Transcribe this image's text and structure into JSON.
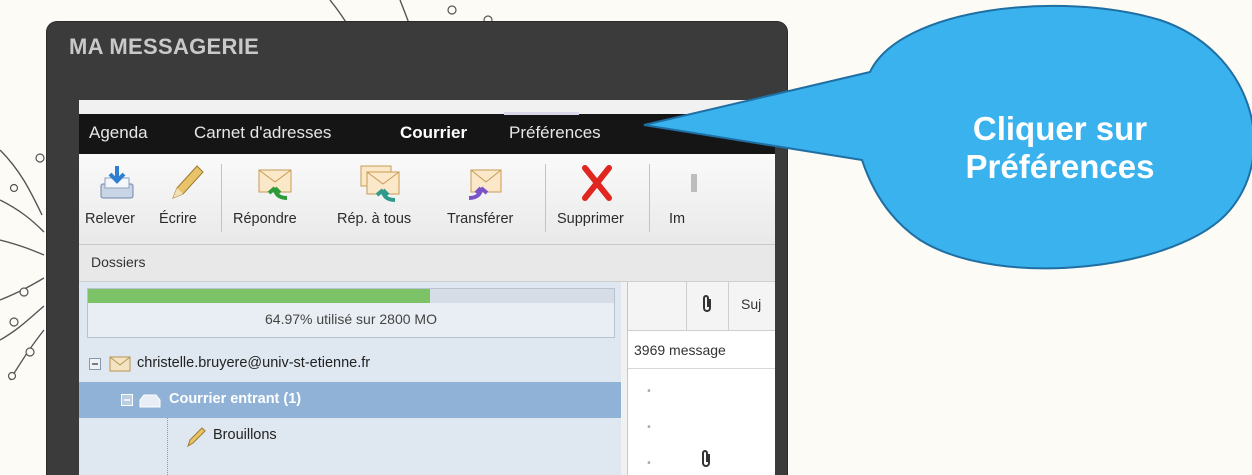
{
  "window": {
    "title": "MA MESSAGERIE"
  },
  "nav": {
    "items": [
      {
        "label": "Agenda"
      },
      {
        "label": "Carnet d'adresses"
      },
      {
        "label": "Courrier",
        "active": true
      },
      {
        "label": "Préférences"
      }
    ]
  },
  "toolbar": {
    "buttons": [
      {
        "label": "Relever",
        "icon": "fetch-mail-icon"
      },
      {
        "label": "Écrire",
        "icon": "pencil-icon"
      },
      {
        "label": "Répondre",
        "icon": "reply-icon"
      },
      {
        "label": "Rép. à tous",
        "icon": "reply-all-icon"
      },
      {
        "label": "Transférer",
        "icon": "forward-icon"
      },
      {
        "label": "Supprimer",
        "icon": "delete-icon"
      },
      {
        "label": "Im",
        "icon": "print-icon"
      }
    ]
  },
  "folders": {
    "header": "Dossiers",
    "quota": {
      "text": "64.97% utilisé sur 2800 MO",
      "percent": 64.97
    },
    "tree": [
      {
        "label": "christelle.bruyere@univ-st-etienne.fr"
      },
      {
        "label": "Courrier entrant (1)"
      },
      {
        "label": "Brouillons"
      }
    ]
  },
  "messages": {
    "column_subject": "Suj",
    "count_text": "3969 message"
  },
  "callout": {
    "line1": "Cliquer sur",
    "line2": "Préférences",
    "color": "#3ab2ee"
  },
  "colors": {
    "navbar": "#151515",
    "quota_fill": "#7cc266",
    "selected_folder": "#8fb2d6"
  }
}
